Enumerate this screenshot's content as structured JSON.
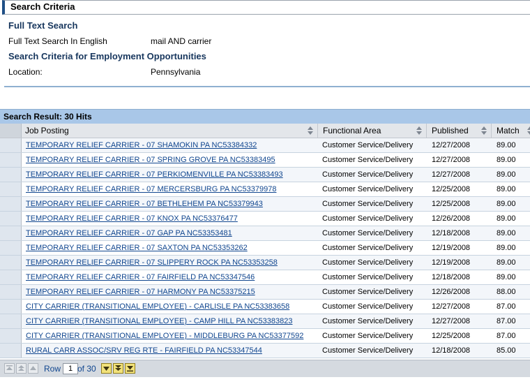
{
  "criteria": {
    "header": "Search Criteria",
    "full_text_title": "Full Text Search",
    "full_text_label": "Full Text Search In English",
    "full_text_value": "mail AND carrier",
    "employment_title": "Search Criteria for Employment Opportunities",
    "location_label": "Location:",
    "location_value": "Pennsylvania"
  },
  "results": {
    "title": "Search Result: 30 Hits",
    "columns": {
      "job": "Job Posting",
      "area": "Functional Area",
      "published": "Published",
      "match": "Match"
    },
    "rows": [
      {
        "job": "TEMPORARY RELIEF CARRIER - 07 SHAMOKIN PA NC53384332",
        "area": "Customer Service/Delivery",
        "published": "12/27/2008",
        "match": "89.00"
      },
      {
        "job": "TEMPORARY RELIEF CARRIER - 07 SPRING GROVE PA NC53383495",
        "area": "Customer Service/Delivery",
        "published": "12/27/2008",
        "match": "89.00"
      },
      {
        "job": "TEMPORARY RELIEF CARRIER - 07 PERKIOMENVILLE PA NC53383493",
        "area": "Customer Service/Delivery",
        "published": "12/27/2008",
        "match": "89.00"
      },
      {
        "job": "TEMPORARY RELIEF CARRIER - 07 MERCERSBURG PA NC53379978",
        "area": "Customer Service/Delivery",
        "published": "12/25/2008",
        "match": "89.00"
      },
      {
        "job": "TEMPORARY RELIEF CARRIER - 07 BETHLEHEM PA NC53379943",
        "area": "Customer Service/Delivery",
        "published": "12/25/2008",
        "match": "89.00"
      },
      {
        "job": "TEMPORARY RELIEF CARRIER - 07 KNOX PA NC53376477",
        "area": "Customer Service/Delivery",
        "published": "12/26/2008",
        "match": "89.00"
      },
      {
        "job": "TEMPORARY RELIEF CARRIER - 07 GAP PA NC53353481",
        "area": "Customer Service/Delivery",
        "published": "12/18/2008",
        "match": "89.00"
      },
      {
        "job": "TEMPORARY RELIEF CARRIER - 07 SAXTON PA NC53353262",
        "area": "Customer Service/Delivery",
        "published": "12/19/2008",
        "match": "89.00"
      },
      {
        "job": "TEMPORARY RELIEF CARRIER - 07 SLIPPERY ROCK PA NC53353258",
        "area": "Customer Service/Delivery",
        "published": "12/19/2008",
        "match": "89.00"
      },
      {
        "job": "TEMPORARY RELIEF CARRIER - 07 FAIRFIELD PA NC53347546",
        "area": "Customer Service/Delivery",
        "published": "12/18/2008",
        "match": "89.00"
      },
      {
        "job": "TEMPORARY RELIEF CARRIER - 07 HARMONY PA NC53375215",
        "area": "Customer Service/Delivery",
        "published": "12/26/2008",
        "match": "88.00"
      },
      {
        "job": "CITY CARRIER (TRANSITIONAL EMPLOYEE) - CARLISLE PA NC53383658",
        "area": "Customer Service/Delivery",
        "published": "12/27/2008",
        "match": "87.00"
      },
      {
        "job": "CITY CARRIER (TRANSITIONAL EMPLOYEE) - CAMP HILL PA NC53383823",
        "area": "Customer Service/Delivery",
        "published": "12/27/2008",
        "match": "87.00"
      },
      {
        "job": "CITY CARRIER (TRANSITIONAL EMPLOYEE) - MIDDLEBURG PA NC53377592",
        "area": "Customer Service/Delivery",
        "published": "12/25/2008",
        "match": "87.00"
      },
      {
        "job": "RURAL CARR ASSOC/SRV REG RTE - FAIRFIELD PA NC53347544",
        "area": "Customer Service/Delivery",
        "published": "12/18/2008",
        "match": "85.00"
      }
    ]
  },
  "pager": {
    "row_label": "Row",
    "row_value": "1",
    "of_label": "of 30"
  },
  "icons": {
    "first": "first-page-icon",
    "prev_page": "previous-page-icon",
    "prev": "previous-row-icon",
    "next": "next-row-icon",
    "next_page": "next-page-icon",
    "last": "last-page-icon"
  },
  "colors": {
    "title_blue": "#17365d",
    "link_blue": "#10468f",
    "result_bar": "#a9c7e8",
    "active_button": "#f2e27a"
  }
}
